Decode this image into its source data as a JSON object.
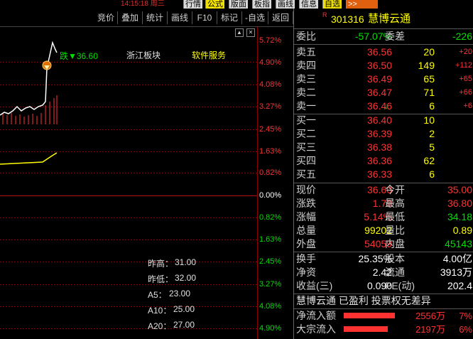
{
  "topbar": {
    "clock": "14:15:18 周三",
    "tabs": [
      "行情",
      "公式",
      "版面",
      "板指",
      "画线",
      "信息",
      "自选",
      ">>"
    ],
    "selected_tab": "公式"
  },
  "toolbar": {
    "items": [
      "竞价",
      "叠加",
      "统计",
      "画线",
      "F10",
      "标记",
      "-自选",
      "返回"
    ]
  },
  "chart": {
    "label_tag": "跌▼36.60",
    "sector1": "浙江板块",
    "sector2": "软件服务",
    "pct_labels_up": [
      "5.72%",
      "4.90%",
      "4.08%",
      "3.27%",
      "2.45%",
      "1.63%",
      "0.82%"
    ],
    "pct_zero": "0.00%",
    "pct_labels_down": [
      "0.82%",
      "1.63%",
      "2.45%",
      "3.27%",
      "4.08%",
      "4.90%"
    ],
    "info": [
      {
        "label": "昨高：",
        "value": "31.00"
      },
      {
        "label": "昨低：",
        "value": "32.00"
      },
      {
        "label": "A5：",
        "value": "23.00"
      },
      {
        "label": "A10：",
        "value": "25.00"
      },
      {
        "label": "A20：",
        "value": "27.00"
      }
    ],
    "colors": {
      "price_line": "#ffffff",
      "avg_line": "#ffff00",
      "up": "#ff3232",
      "down": "#00e000",
      "grid": "#8b0000"
    }
  },
  "panel": {
    "code": "301316",
    "name": "慧博云通",
    "wei_bi_label": "委比",
    "wei_bi": "-57.07%",
    "wei_cha_label": "委差",
    "wei_cha": "-226",
    "sells": [
      {
        "label": "卖五",
        "price": "36.56",
        "vol": "20",
        "chg": "+20"
      },
      {
        "label": "卖四",
        "price": "36.50",
        "vol": "149",
        "chg": "+112"
      },
      {
        "label": "卖三",
        "price": "36.49",
        "vol": "65",
        "chg": "+65"
      },
      {
        "label": "卖二",
        "price": "36.47",
        "vol": "71",
        "chg": "+66"
      },
      {
        "label": "卖一",
        "price": "36.46",
        "vol": "6",
        "chg": "+6"
      }
    ],
    "buys": [
      {
        "label": "买一",
        "price": "36.40",
        "vol": "10"
      },
      {
        "label": "买二",
        "price": "36.39",
        "vol": "2"
      },
      {
        "label": "买三",
        "price": "36.38",
        "vol": "5"
      },
      {
        "label": "买四",
        "price": "36.36",
        "vol": "62"
      },
      {
        "label": "买五",
        "price": "36.33",
        "vol": "6"
      }
    ],
    "stats": [
      {
        "l1": "现价",
        "v1": "36.60",
        "l2": "今开",
        "v2": "35.00"
      },
      {
        "l1": "涨跌",
        "v1": "1.79",
        "l2": "最高",
        "v2": "36.80"
      },
      {
        "l1": "涨幅",
        "v1": "5.14%",
        "l2": "最低",
        "v2": "34.18"
      },
      {
        "l1": "总量",
        "v1": "99202",
        "l2": "量比",
        "v2": "0.89"
      },
      {
        "l1": "外盘",
        "v1": "54059",
        "l2": "内盘",
        "v2": "45143"
      }
    ],
    "stats2": [
      {
        "l1": "换手",
        "v1": "25.35%",
        "l2": "股本",
        "v2": "4.00亿"
      },
      {
        "l1": "净资",
        "v1": "2.42",
        "l2": "流通",
        "v2": "3913万"
      },
      {
        "l1": "收益(三)",
        "v1": "0.090",
        "l2": "PE(动)",
        "v2": "202.4"
      }
    ],
    "comment": "慧博云通 已盈利 投票权无差异",
    "flows": [
      {
        "label": "净流入额",
        "value": "2556万",
        "pct": "7%",
        "bar": 0.6
      },
      {
        "label": "大宗流入",
        "value": "2197万",
        "pct": "6%",
        "bar": 0.52
      }
    ]
  }
}
